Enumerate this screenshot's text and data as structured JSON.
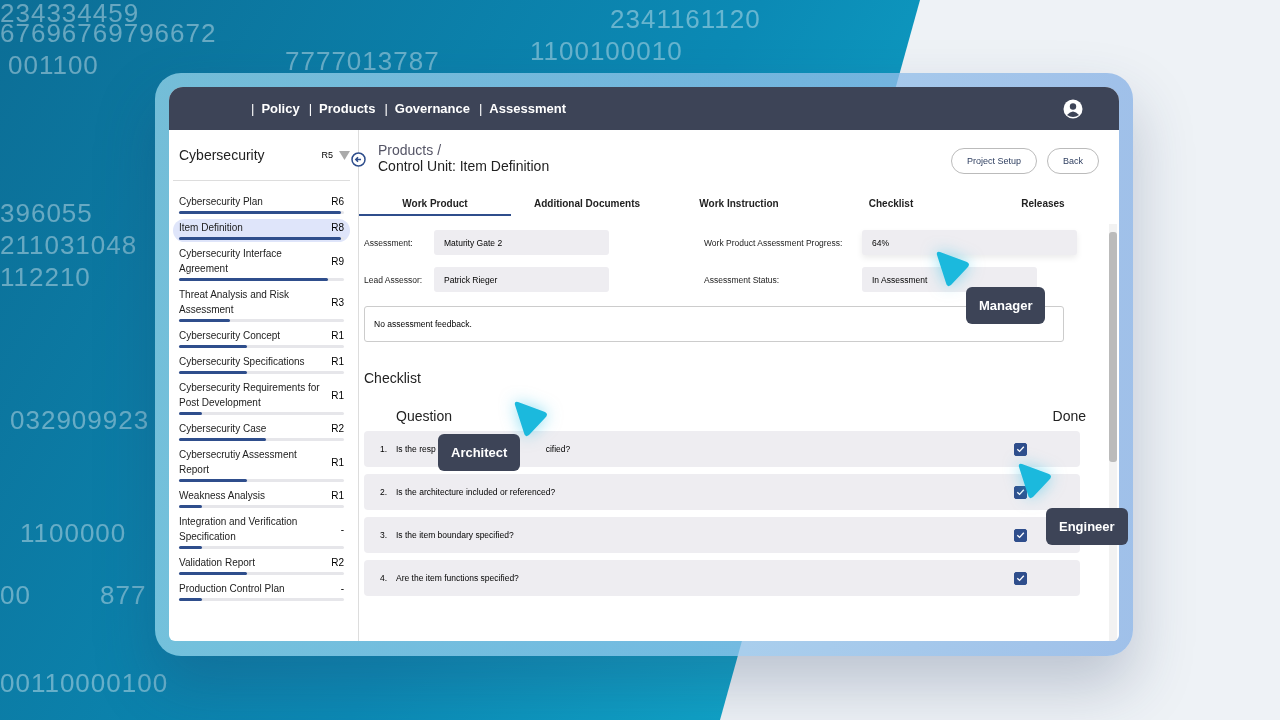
{
  "background_numbers": [
    "234334459",
    "67696769796672",
    "001100",
    "7777013787",
    "2341161120",
    "1100100010",
    "396055",
    "211031048",
    "112210",
    "032909923",
    "1100000",
    "00",
    "877",
    "00110000100"
  ],
  "nav": {
    "separator": "|",
    "items": [
      {
        "label": "Policy"
      },
      {
        "label": "Products"
      },
      {
        "label": "Governance"
      },
      {
        "label": "Assessment"
      }
    ]
  },
  "sidebar": {
    "title": "Cybersecurity",
    "release": "R5",
    "items": [
      {
        "label": "Cybersecurity Plan",
        "release": "R6",
        "level": 0.98,
        "selected": false
      },
      {
        "label": "Item Definition",
        "release": "R8",
        "level": 0.98,
        "selected": true
      },
      {
        "label": "Cybersecurity Interface Agreement",
        "release": "R9",
        "level": 0.9,
        "selected": false
      },
      {
        "label": "Threat Analysis and Risk Assessment",
        "release": "R3",
        "level": 0.31,
        "selected": false
      },
      {
        "label": "Cybersecurity Concept",
        "release": "R1",
        "level": 0.41,
        "selected": false
      },
      {
        "label": "Cybersecurity Specifications",
        "release": "R1",
        "level": 0.41,
        "selected": false
      },
      {
        "label": "Cybersecurity Requirements for Post Development",
        "release": "R1",
        "level": 0.14,
        "selected": false
      },
      {
        "label": "Cybersecurity Case",
        "release": "R2",
        "level": 0.53,
        "selected": false
      },
      {
        "label": "Cybersecrutiy Assessment Report",
        "release": "R1",
        "level": 0.41,
        "selected": false
      },
      {
        "label": "Weakness Analysis",
        "release": "R1",
        "level": 0.14,
        "selected": false
      },
      {
        "label": "Integration and Verification Specification",
        "release": "-",
        "level": 0.14,
        "selected": false
      },
      {
        "label": "Validation Report",
        "release": "R2",
        "level": 0.41,
        "selected": false
      },
      {
        "label": "Production Control Plan",
        "release": "-",
        "level": 0.14,
        "selected": false
      }
    ]
  },
  "breadcrumb": "Products /",
  "page_title": "Control Unit: Item Definition",
  "buttons": [
    "Project Setup",
    "Back"
  ],
  "tabs": [
    {
      "label": "Work Product",
      "selected": true
    },
    {
      "label": "Additional Documents",
      "selected": false
    },
    {
      "label": "Work Instruction",
      "selected": false
    },
    {
      "label": "Checklist",
      "selected": false
    },
    {
      "label": "Releases",
      "selected": false
    }
  ],
  "fields": [
    {
      "label": "Assessment:",
      "value": "Maturity Gate 2"
    },
    {
      "label": "Work Product Assessment Progress:",
      "value": "64%"
    },
    {
      "label": "Lead Assessor:",
      "value": "Patrick Rieger"
    },
    {
      "label": "Assessment Status:",
      "value": "In Assessment"
    }
  ],
  "feedback": "No assessment feedback.",
  "checklist": {
    "title": "Checklist",
    "columns": [
      "Question",
      "Done"
    ],
    "rows": [
      {
        "number": "1.",
        "question_parts": [
          "Is the resp",
          "cified?"
        ],
        "checked": true
      },
      {
        "number": "2.",
        "question_parts": [
          "Is the architecture included or referenced?"
        ],
        "checked": true
      },
      {
        "number": "3.",
        "question_parts": [
          "Is the item boundary specified?"
        ],
        "checked": true
      },
      {
        "number": "4.",
        "question_parts": [
          "Are the item functions specified?"
        ],
        "checked": true
      }
    ]
  },
  "cursors": [
    {
      "label": "Manager"
    },
    {
      "label": "Architect"
    },
    {
      "label": "Engineer"
    }
  ]
}
